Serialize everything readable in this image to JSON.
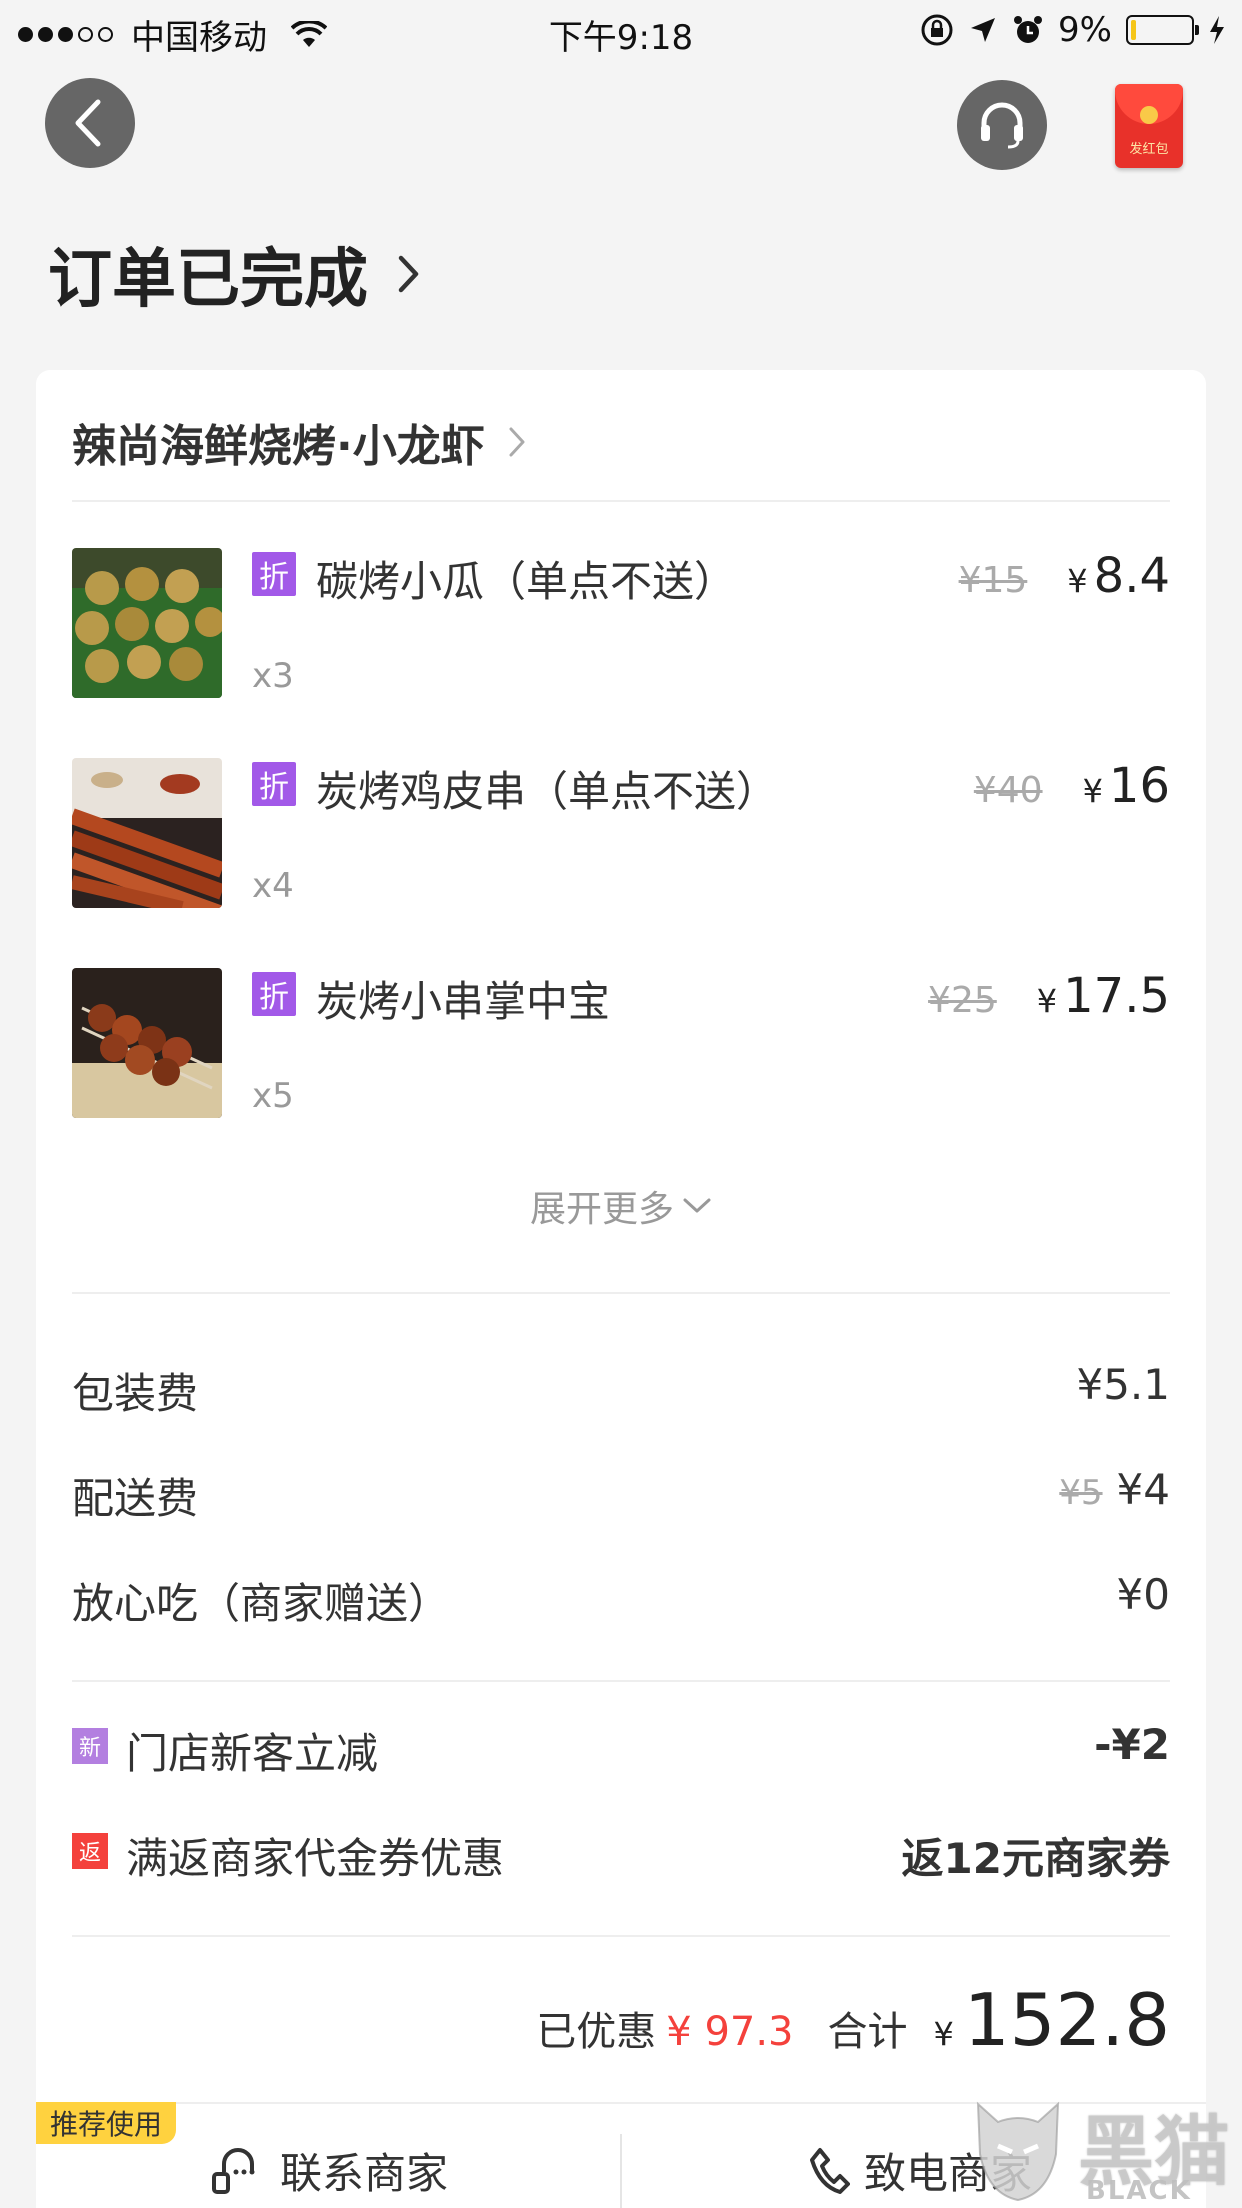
{
  "status_bar": {
    "carrier": "中国移动",
    "time": "下午9:18",
    "battery": "9%",
    "battery_level": 0.09
  },
  "header": {
    "red_packet_label": "发红包"
  },
  "order": {
    "status": "订单已完成"
  },
  "shop": {
    "name": "辣尚海鲜烧烤·小龙虾"
  },
  "items": [
    {
      "badge": "折",
      "name": "碳烤小瓜（单点不送）",
      "qty": "x3",
      "orig_price": "¥15",
      "price": "8.4",
      "yen": "¥"
    },
    {
      "badge": "折",
      "name": "炭烤鸡皮串（单点不送）",
      "qty": "x4",
      "orig_price": "¥40",
      "price": "16",
      "yen": "¥"
    },
    {
      "badge": "折",
      "name": "炭烤小串掌中宝",
      "qty": "x5",
      "orig_price": "¥25",
      "price": "17.5",
      "yen": "¥"
    }
  ],
  "expand_label": "展开更多",
  "fees": [
    {
      "label": "包装费",
      "value": "¥5.1",
      "orig": ""
    },
    {
      "label": "配送费",
      "value": "¥4",
      "orig": "¥5"
    },
    {
      "label": "放心吃（商家赠送）",
      "value": "¥0",
      "orig": ""
    }
  ],
  "promos": [
    {
      "badge": "新",
      "badge_color": "#b37fe0",
      "label": "门店新客立减",
      "value": "-¥2"
    },
    {
      "badge": "返",
      "badge_color": "#f4413c",
      "label": "满返商家代金券优惠",
      "value": "返12元商家券"
    }
  ],
  "summary": {
    "saved_label": "已优惠",
    "saved_value": "¥ 97.3",
    "total_label": "合计",
    "total_yen": "¥",
    "total_value": "152.8"
  },
  "bottom": {
    "recommend": "推荐使用",
    "contact_merchant": "联系商家",
    "call_merchant": "致电商家"
  },
  "watermark": {
    "cn": "黑猫",
    "en": "BLACK CAT"
  },
  "colors": {
    "badge_purple": "#a259e8",
    "discount_red": "#f4413c",
    "recommend_yellow": "#ffd23f"
  }
}
